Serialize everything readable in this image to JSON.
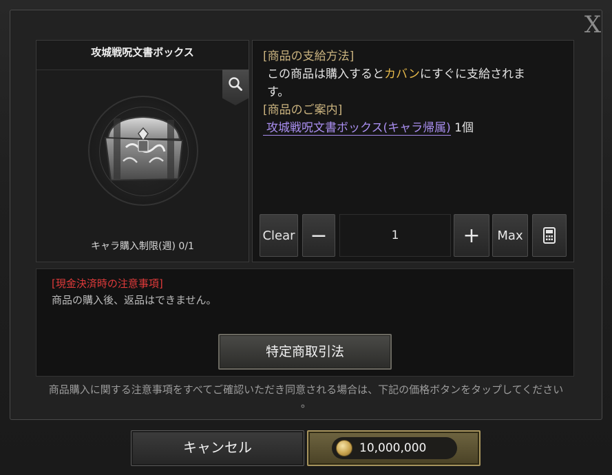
{
  "dialog": {
    "close_label": "X"
  },
  "product": {
    "title": "攻城戦呪文書ボックス",
    "purchase_limit": "キャラ購入制限(週) 0/1"
  },
  "description": {
    "section1_title": "[商品の支給方法]",
    "line1_part1": "この商品は購入すると",
    "line1_highlight": "カバン",
    "line1_part2": "にすぐに支給されま",
    "line2": "す。",
    "section2_title": "[商品のご案内]",
    "item_link": "攻城戦呪文書ボックス(キャラ帰属)",
    "item_count": "1個"
  },
  "quantity": {
    "clear_label": "Clear",
    "minus_label": "−",
    "value": "1",
    "plus_label": "+",
    "max_label": "Max"
  },
  "notice": {
    "title": "[現金決済時の注意事項]",
    "text": "商品の購入後、返品はできません。",
    "law_button": "特定商取引法"
  },
  "agreement": {
    "line1": "商品購入に関する注意事項をすべてご確認いただき同意される場合は、下記の価格ボタンをタップしてください",
    "line2": "。"
  },
  "footer": {
    "cancel_label": "キャンセル",
    "price": "10,000,000"
  }
}
